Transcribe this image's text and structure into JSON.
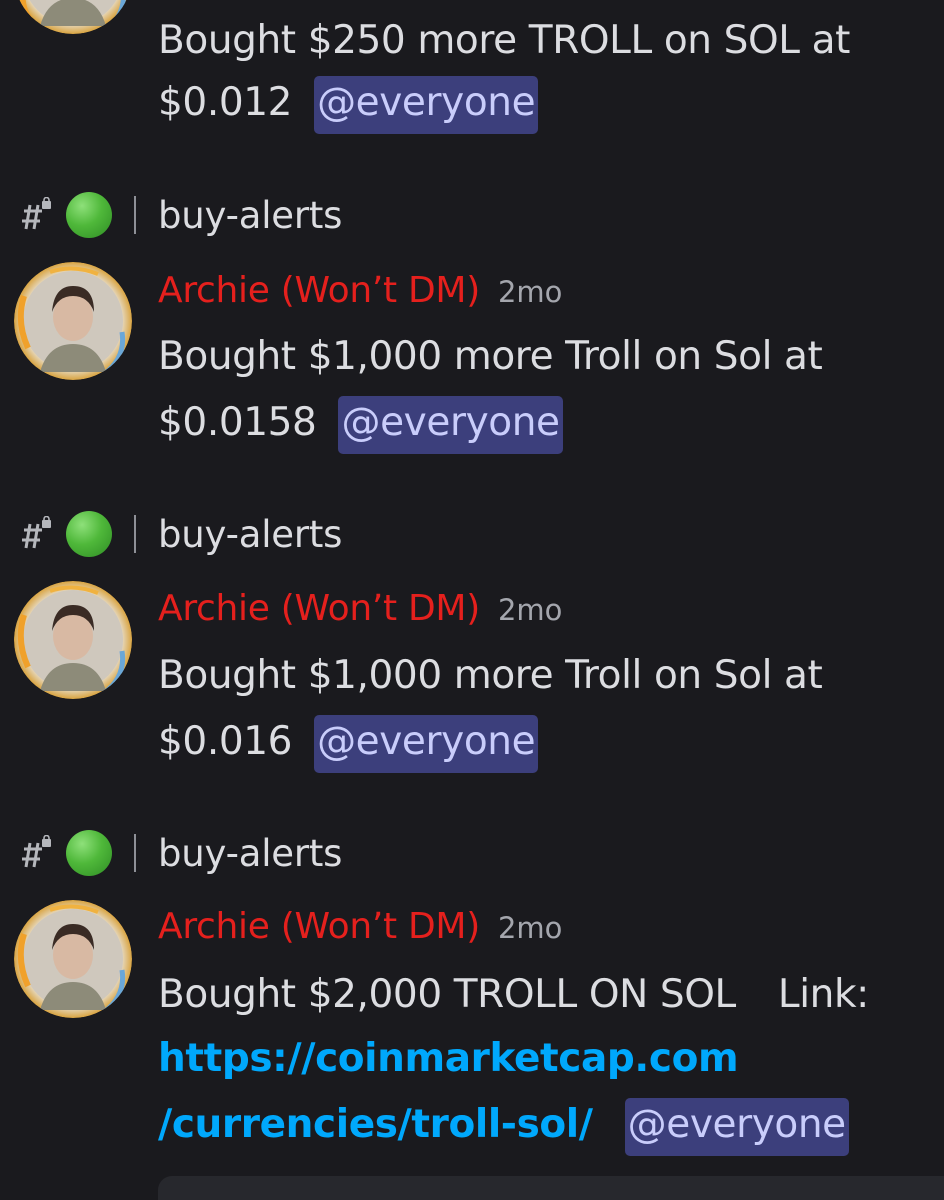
{
  "messages": [
    {
      "text_line1": "Bought $250 more TROLL on SOL at",
      "text_line2": "$0.012",
      "mention": "@everyone"
    },
    {
      "channel": {
        "icon": "hash-lock-icon",
        "status": "green-circle",
        "name": "buy-alerts"
      },
      "author": "Archie (Won’t DM)",
      "timestamp": "2mo",
      "text_line1": "Bought $1,000 more Troll on Sol at",
      "text_line2": "$0.0158",
      "mention": "@everyone"
    },
    {
      "channel": {
        "icon": "hash-lock-icon",
        "status": "green-circle",
        "name": "buy-alerts"
      },
      "author": "Archie (Won’t DM)",
      "timestamp": "2mo",
      "text_line1": "Bought $1,000 more Troll on Sol at",
      "text_line2": "$0.016",
      "mention": "@everyone"
    },
    {
      "channel": {
        "icon": "hash-lock-icon",
        "status": "green-circle",
        "name": "buy-alerts"
      },
      "author": "Archie (Won’t DM)",
      "timestamp": "2mo",
      "text_line1": "Bought $2,000 TROLL ON SOL",
      "link_label": "Link:",
      "link_line1": "https://coinmarketcap.com",
      "link_line2": "/currencies/troll-sol/",
      "mention": "@everyone"
    }
  ],
  "colors": {
    "background": "#1a1a1e",
    "author": "#e5201d",
    "mention_bg": "#3c3f7c",
    "mention_text": "#c9cdfb",
    "link": "#00a8fc",
    "timestamp": "#a4a6ad"
  }
}
